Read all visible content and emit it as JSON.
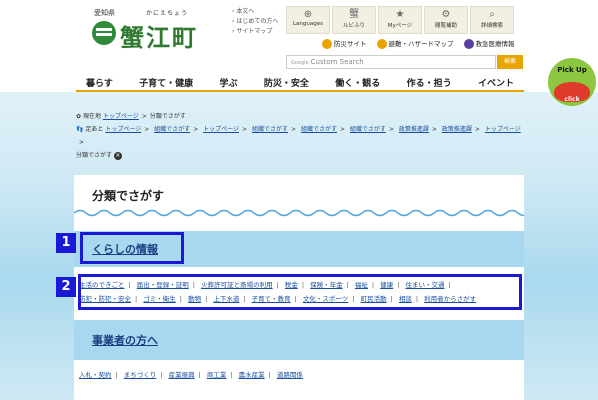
{
  "header": {
    "prefecture": "愛知県",
    "ruby": "かにえちょう",
    "town_name": "蟹江町",
    "top_links": [
      "本文へ",
      "はじめての方へ",
      "サイトマップ"
    ],
    "icon_buttons": [
      {
        "label": "Languages",
        "icon": "globe-icon",
        "glyph": "⊕"
      },
      {
        "label": "ルビふり",
        "icon": "kanji-icon",
        "glyph": "蟹"
      },
      {
        "label": "Myページ",
        "icon": "star-icon",
        "glyph": "★"
      },
      {
        "label": "閲覧補助",
        "icon": "gear-icon",
        "glyph": "⚙"
      },
      {
        "label": "詳細検索",
        "icon": "search-icon",
        "glyph": "⌕"
      }
    ],
    "sub_nav": [
      {
        "label": "防災サイト",
        "color": "#e8a400"
      },
      {
        "label": "避難・ハザードマップ",
        "color": "#e8a400"
      },
      {
        "label": "救急医療情報",
        "color": "#5a3fa0"
      }
    ],
    "search": {
      "brand": "Google",
      "placeholder": "Custom Search",
      "button": "検索"
    },
    "main_nav": [
      "暮らす",
      "子育て・健康",
      "学ぶ",
      "防災・安全",
      "働く・観る",
      "作る・担う",
      "イベント"
    ],
    "pickup": {
      "line1": "Pick Up",
      "click": "click"
    }
  },
  "breadcrumb": {
    "current_label": "現在地",
    "current": [
      "トップページ",
      "分類でさがす"
    ],
    "trail_label": "足あと",
    "trail": [
      "トップページ",
      "組織でさがす",
      "トップページ",
      "組織でさがす",
      "組織でさがす",
      "組織でさがす",
      "政策推進課",
      "政策推進課",
      "トップページ",
      "分類でさがす"
    ]
  },
  "main": {
    "page_title": "分類でさがす",
    "sections": [
      {
        "heading": "くらしの情報",
        "links_row1": [
          "生活のできごと",
          "届出・登録・証明",
          "火葬許可証と斎場の利用",
          "税金",
          "保険・年金",
          "福祉",
          "健康",
          "住まい・交通"
        ],
        "links_row2": [
          "防犯・防犯・安全",
          "ゴミ・衛生",
          "動物",
          "上下水道",
          "子育て・教育",
          "文化・スポーツ",
          "町民活動",
          "相談",
          "利用者からさがす"
        ]
      },
      {
        "heading": "事業者の方へ",
        "links_row1": [
          "入札・契約",
          "まちづくり",
          "産業振興",
          "商工業",
          "農水産業",
          "道路関係"
        ]
      }
    ]
  },
  "annotations": {
    "first": "1",
    "second": "2",
    "color": "#1a1ad6"
  }
}
